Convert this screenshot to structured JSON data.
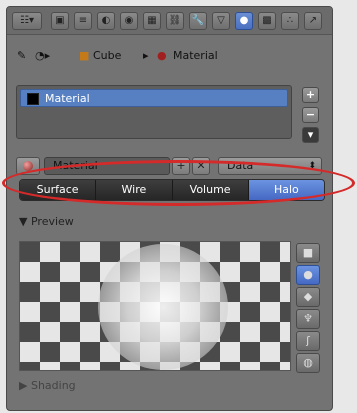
{
  "toolbar": {
    "buttons": [
      {
        "name": "render-icon",
        "glyph": "▣"
      },
      {
        "name": "layers-icon",
        "glyph": "≡"
      },
      {
        "name": "scene-icon",
        "glyph": "◐"
      },
      {
        "name": "world-icon",
        "glyph": "◉"
      },
      {
        "name": "object-icon",
        "glyph": "▦"
      },
      {
        "name": "constraints-icon",
        "glyph": "⛓"
      },
      {
        "name": "modifiers-icon",
        "glyph": "🔧"
      },
      {
        "name": "data-icon",
        "glyph": "▽"
      },
      {
        "name": "material-icon",
        "glyph": "●",
        "active": true
      },
      {
        "name": "texture-icon",
        "glyph": "▩"
      },
      {
        "name": "particles-icon",
        "glyph": "∴"
      },
      {
        "name": "physics-icon",
        "glyph": "↗"
      }
    ]
  },
  "context": {
    "object": "Cube",
    "material": "Material"
  },
  "slots": [
    {
      "label": "Material",
      "swatch": "#000000"
    }
  ],
  "slot_buttons": {
    "add": "+",
    "remove": "−",
    "menu": "▾"
  },
  "material_field": {
    "name": "Material",
    "add_glyph": "+",
    "del_glyph": "✕",
    "link": "Data"
  },
  "tabs": [
    {
      "label": "Surface",
      "active": false
    },
    {
      "label": "Wire",
      "active": false
    },
    {
      "label": "Volume",
      "active": false
    },
    {
      "label": "Halo",
      "active": true
    }
  ],
  "sections": {
    "preview": "Preview",
    "shading": "Shading"
  },
  "preview_tools": [
    {
      "name": "flat-preview-icon",
      "glyph": "■",
      "active": false
    },
    {
      "name": "sphere-preview-icon",
      "glyph": "●",
      "active": true
    },
    {
      "name": "cube-preview-icon",
      "glyph": "◆",
      "active": false
    },
    {
      "name": "monkey-preview-icon",
      "glyph": "♆",
      "active": false
    },
    {
      "name": "hair-preview-icon",
      "glyph": "ʃ",
      "active": false
    },
    {
      "name": "sky-preview-icon",
      "glyph": "◍",
      "active": false
    }
  ],
  "colors": {
    "accent": "#5680c2",
    "annotation": "#d42a2a"
  }
}
